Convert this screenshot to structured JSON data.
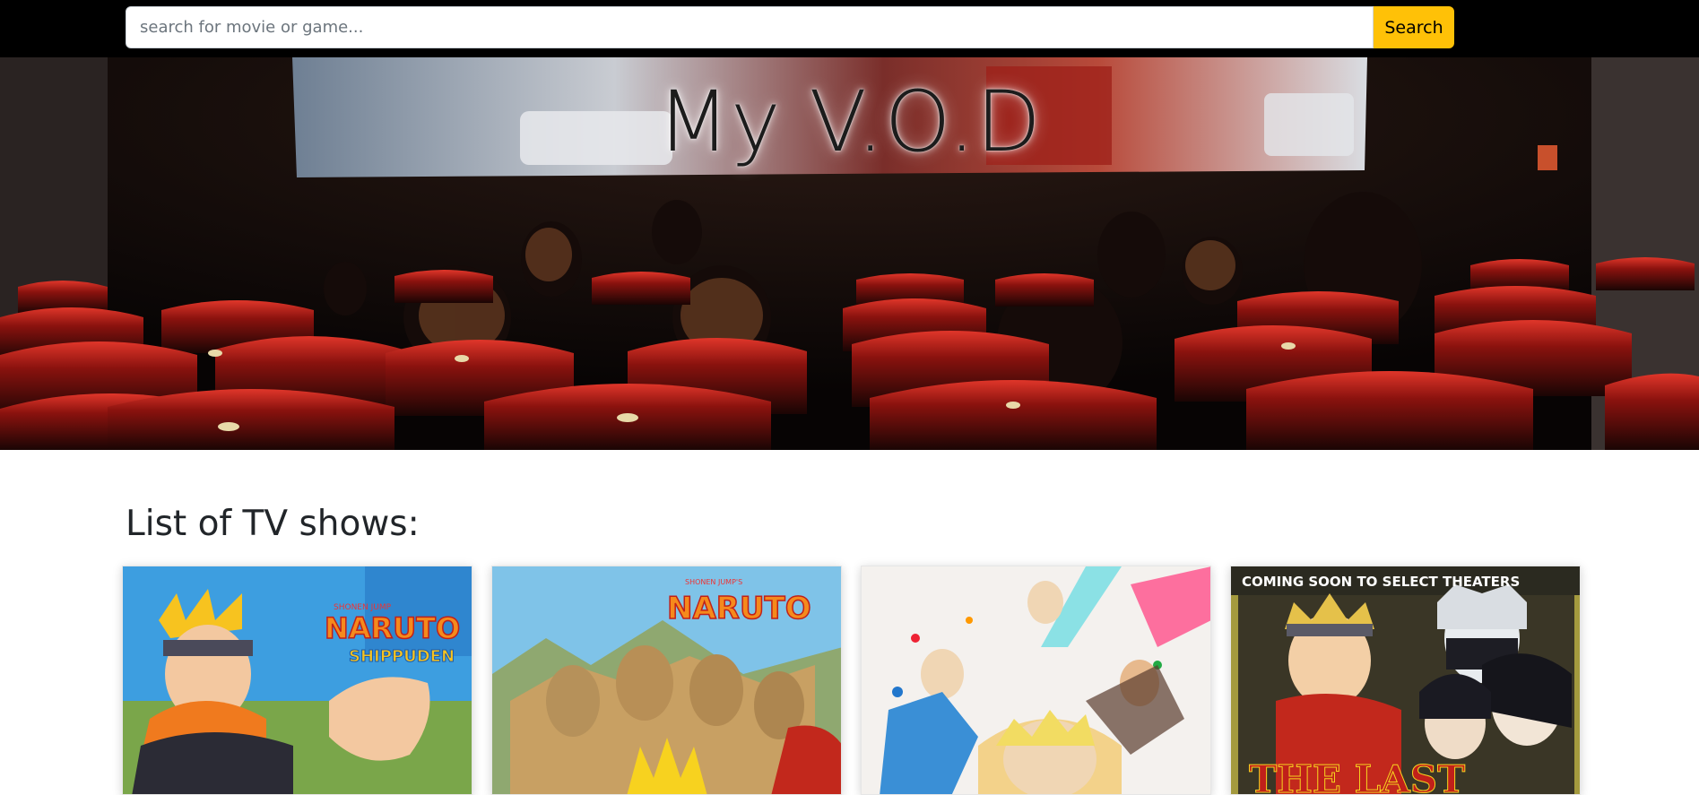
{
  "search": {
    "placeholder": "search for movie or game...",
    "button_label": "Search"
  },
  "hero": {
    "title": "My V.O.D"
  },
  "tv_shows": {
    "heading": "List of TV shows:",
    "items": [
      {
        "poster_text_1": "SHONEN JUMP",
        "poster_text_2": "NARUTO",
        "poster_text_3": "SHIPPUDEN"
      },
      {
        "poster_text_1": "SHONEN JUMP'S",
        "poster_text_2": "NARUTO"
      },
      {
        "poster_text_1": ""
      },
      {
        "poster_text_1": "COMING SOON TO SELECT THEATERS",
        "poster_text_2": "THE LAST"
      }
    ]
  },
  "colors": {
    "topbar": "#000000",
    "search_button": "#ffc107",
    "seat_red": "#c0201a"
  }
}
